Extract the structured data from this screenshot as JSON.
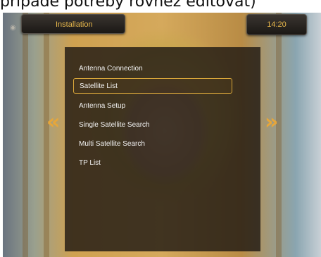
{
  "caption": "případě potřeby rovněž editovat)",
  "header": {
    "title": "Installation",
    "clock": "14:20"
  },
  "menu": {
    "items": [
      {
        "label": "Antenna Connection"
      },
      {
        "label": "Satellite List"
      },
      {
        "label": "Antenna Setup"
      },
      {
        "label": "Single Satellite Search"
      },
      {
        "label": "Multi Satellite Search"
      },
      {
        "label": "TP List"
      }
    ],
    "selected": "Satellite List"
  },
  "nav": {
    "left_glyph": "«",
    "right_glyph": "»"
  },
  "colors": {
    "accent": "#e8b84b",
    "panel": "#201a14",
    "text": "#f2f2f2"
  }
}
